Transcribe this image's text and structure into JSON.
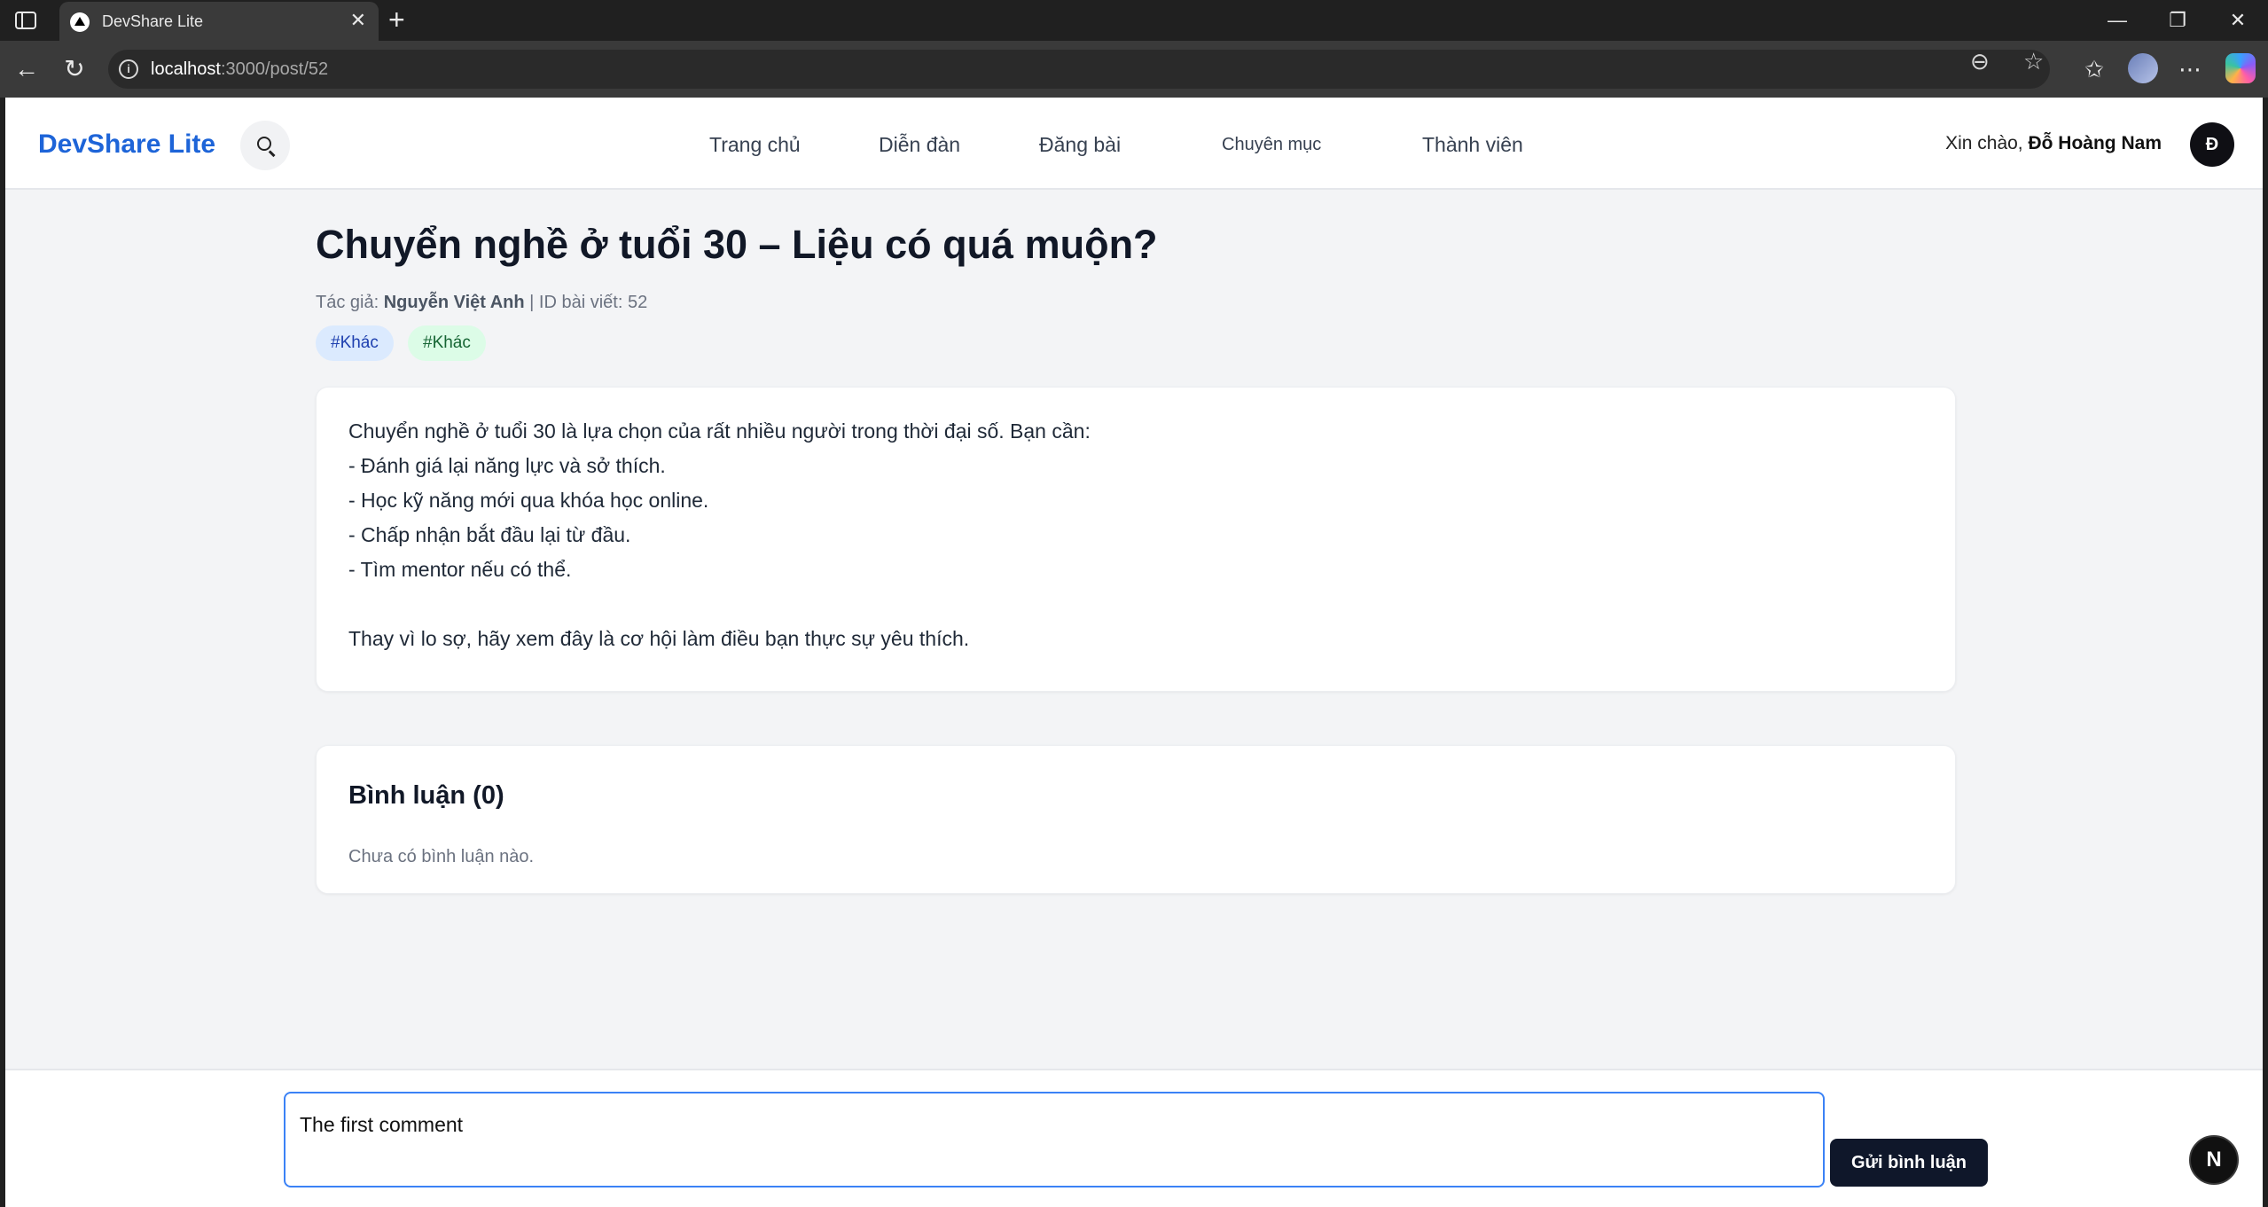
{
  "browser": {
    "tab_title": "DevShare Lite",
    "tab_close": "✕",
    "new_tab": "+",
    "url_host": "localhost",
    "url_path": ":3000/post/52",
    "window": {
      "minimize": "—",
      "restore": "❐",
      "close": "✕"
    },
    "icons": {
      "back": "←",
      "reload": "↻",
      "read_aloud": "⊖",
      "favorite": "☆",
      "favorites": "✩",
      "more": "⋯"
    }
  },
  "header": {
    "brand": "DevShare Lite",
    "nav": [
      "Trang chủ",
      "Diễn đàn",
      "Đăng bài",
      "Chuyên mục",
      "Thành viên"
    ],
    "greeting": "Xin chào, ",
    "user_name": "Đỗ Hoàng Nam",
    "avatar_initial": "Đ"
  },
  "post": {
    "title": "Chuyển nghề ở tuổi 30 – Liệu có quá muộn?",
    "author_label": "Tác giả: ",
    "author": "Nguyễn Việt Anh",
    "id_text": " | ID bài viết: 52",
    "tags": [
      "#Khác",
      "#Khác"
    ],
    "content": [
      "Chuyển nghề ở tuổi 30 là lựa chọn của rất nhiều người trong thời đại số. Bạn cần:",
      "- Đánh giá lại năng lực và sở thích.",
      "- Học kỹ năng mới qua khóa học online.",
      "- Chấp nhận bắt đầu lại từ đầu.",
      "- Tìm mentor nếu có thể.",
      "Thay vì lo sợ, hãy xem đây là cơ hội làm điều bạn thực sự yêu thích."
    ]
  },
  "comments": {
    "title": "Bình luận (0)",
    "empty": "Chưa có bình luận nào.",
    "input_value": "The first comment",
    "submit_label": "Gửi bình luận"
  },
  "dev_badge": "N"
}
